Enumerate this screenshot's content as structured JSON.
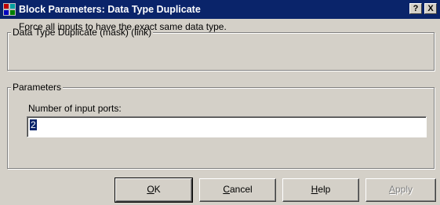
{
  "titlebar": {
    "title": "Block Parameters: Data Type Duplicate",
    "help_glyph": "?",
    "close_glyph": "X",
    "app_icon": "simulink-block-icon",
    "active_color": "#0a246a"
  },
  "description_group": {
    "legend": "Data Type Duplicate (mask) (link)",
    "text": "Force all inputs to have the exact same data type."
  },
  "parameters_group": {
    "legend": "Parameters",
    "field_label": "Number of input ports:",
    "field_value": "2"
  },
  "buttons": {
    "ok": {
      "accel": "O",
      "rest": "K"
    },
    "cancel": {
      "accel": "C",
      "rest": "ancel"
    },
    "help": {
      "accel": "H",
      "rest": "elp"
    },
    "apply": {
      "accel": "A",
      "rest": "pply",
      "enabled": false
    }
  }
}
